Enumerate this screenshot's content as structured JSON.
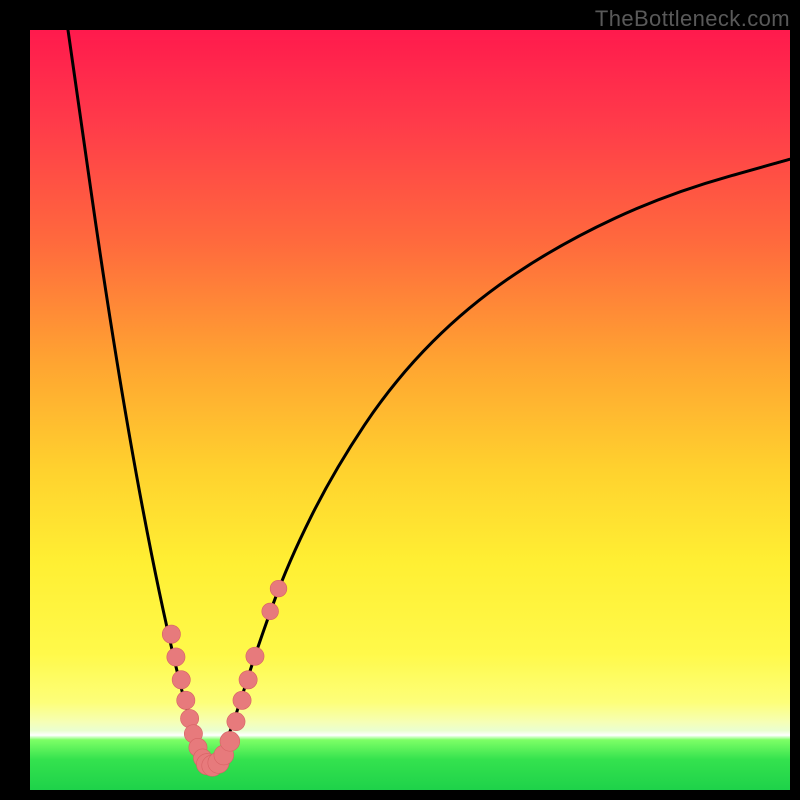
{
  "watermark": "TheBottleneck.com",
  "colors": {
    "page_bg": "#000000",
    "curve": "#000000",
    "marker_fill": "#e77a7c",
    "marker_stroke": "#d76264"
  },
  "chart_data": {
    "type": "line",
    "title": "",
    "xlabel": "",
    "ylabel": "",
    "xlim": [
      0,
      100
    ],
    "ylim": [
      0,
      100
    ],
    "grid": false,
    "legend": false,
    "note": "No numeric axis ticks or labels are rendered in the image; x and y values are estimated in percent of the plot area.",
    "series": [
      {
        "name": "left-branch",
        "x": [
          5,
          7,
          9,
          11,
          13,
          15,
          17,
          19,
          20.5,
          22,
          23,
          23.7
        ],
        "y": [
          100,
          86,
          72,
          59,
          47,
          36,
          26,
          17,
          11,
          6.3,
          3.8,
          3.2
        ]
      },
      {
        "name": "right-branch",
        "x": [
          23.7,
          25,
          27,
          30,
          34,
          40,
          48,
          58,
          70,
          84,
          100
        ],
        "y": [
          3.2,
          4.2,
          9.5,
          19,
          30,
          42,
          54,
          64,
          72,
          78.5,
          83
        ]
      }
    ],
    "markers": [
      {
        "x": 18.6,
        "y": 20.5,
        "r": 1.2
      },
      {
        "x": 19.2,
        "y": 17.5,
        "r": 1.2
      },
      {
        "x": 19.9,
        "y": 14.5,
        "r": 1.2
      },
      {
        "x": 20.5,
        "y": 11.8,
        "r": 1.2
      },
      {
        "x": 21.0,
        "y": 9.4,
        "r": 1.2
      },
      {
        "x": 21.5,
        "y": 7.4,
        "r": 1.2
      },
      {
        "x": 22.1,
        "y": 5.6,
        "r": 1.2
      },
      {
        "x": 22.7,
        "y": 4.2,
        "r": 1.2
      },
      {
        "x": 23.3,
        "y": 3.4,
        "r": 1.4
      },
      {
        "x": 24.0,
        "y": 3.2,
        "r": 1.4
      },
      {
        "x": 24.8,
        "y": 3.6,
        "r": 1.4
      },
      {
        "x": 25.5,
        "y": 4.6,
        "r": 1.3
      },
      {
        "x": 26.3,
        "y": 6.4,
        "r": 1.3
      },
      {
        "x": 27.1,
        "y": 9.0,
        "r": 1.2
      },
      {
        "x": 27.9,
        "y": 11.8,
        "r": 1.2
      },
      {
        "x": 28.7,
        "y": 14.5,
        "r": 1.2
      },
      {
        "x": 29.6,
        "y": 17.6,
        "r": 1.2
      },
      {
        "x": 31.6,
        "y": 23.5,
        "r": 1.1
      },
      {
        "x": 32.7,
        "y": 26.5,
        "r": 1.1
      }
    ]
  }
}
